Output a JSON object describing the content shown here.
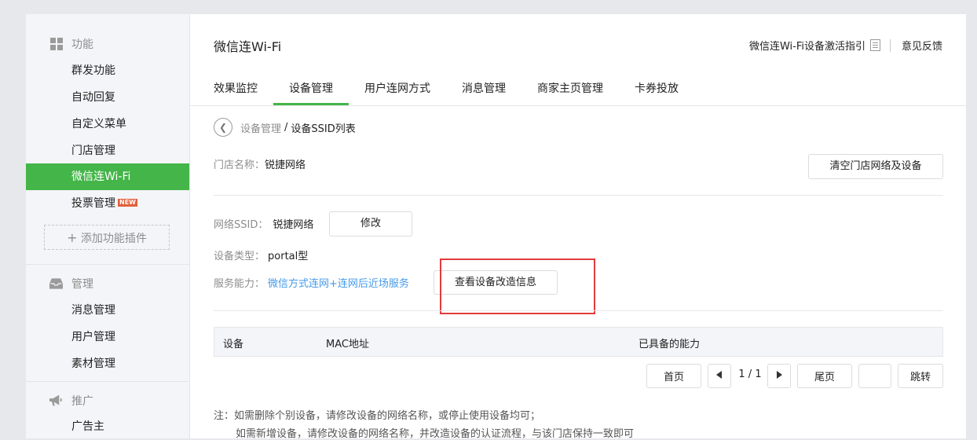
{
  "sidebar": {
    "sections": [
      {
        "title": "功能",
        "icon": "grid-icon"
      },
      {
        "title": "管理",
        "icon": "inbox-icon"
      },
      {
        "title": "推广",
        "icon": "megaphone-icon"
      }
    ],
    "function_items": [
      "群发功能",
      "自动回复",
      "自定义菜单",
      "门店管理",
      "微信连Wi-Fi",
      "投票管理"
    ],
    "new_badge": "NEW",
    "add_plugin": "添加功能插件",
    "manage_items": [
      "消息管理",
      "用户管理",
      "素材管理"
    ],
    "promo_items": [
      "广告主"
    ]
  },
  "header": {
    "title": "微信连Wi-Fi",
    "guide_link": "微信连Wi-Fi设备激活指引",
    "feedback_link": "意见反馈"
  },
  "tabs": [
    "效果监控",
    "设备管理",
    "用户连网方式",
    "消息管理",
    "商家主页管理",
    "卡券投放"
  ],
  "breadcrumb": {
    "parent": "设备管理",
    "separator": "/",
    "current": "设备SSID列表"
  },
  "store": {
    "label": "门店名称：",
    "name": "锐捷网络",
    "clear_button": "清空门店网络及设备"
  },
  "network": {
    "ssid_label": "网络SSID：",
    "ssid_value": "锐捷网络",
    "edit_button": "修改",
    "type_label": "设备类型：",
    "type_value": "portal型",
    "capability_label": "服务能力：",
    "capability_value": "微信方式连网+连网后近场服务",
    "view_button": "查看设备改造信息"
  },
  "table": {
    "headers": [
      "设备",
      "MAC地址",
      "已具备的能力"
    ]
  },
  "pagination": {
    "first": "首页",
    "page_display": "1 / 1",
    "last": "尾页",
    "jump_input": "",
    "jump_button": "跳转"
  },
  "notes": {
    "line1": "注：如需删除个别设备，请修改设备的网络名称，或停止使用设备均可；",
    "line2": "如需新增设备，请修改设备的网络名称，并改造设备的认证流程，与该门店保持一致即可"
  },
  "colors": {
    "accent": "#44b549",
    "link": "#459ae9",
    "highlight": "#e33b3b"
  }
}
